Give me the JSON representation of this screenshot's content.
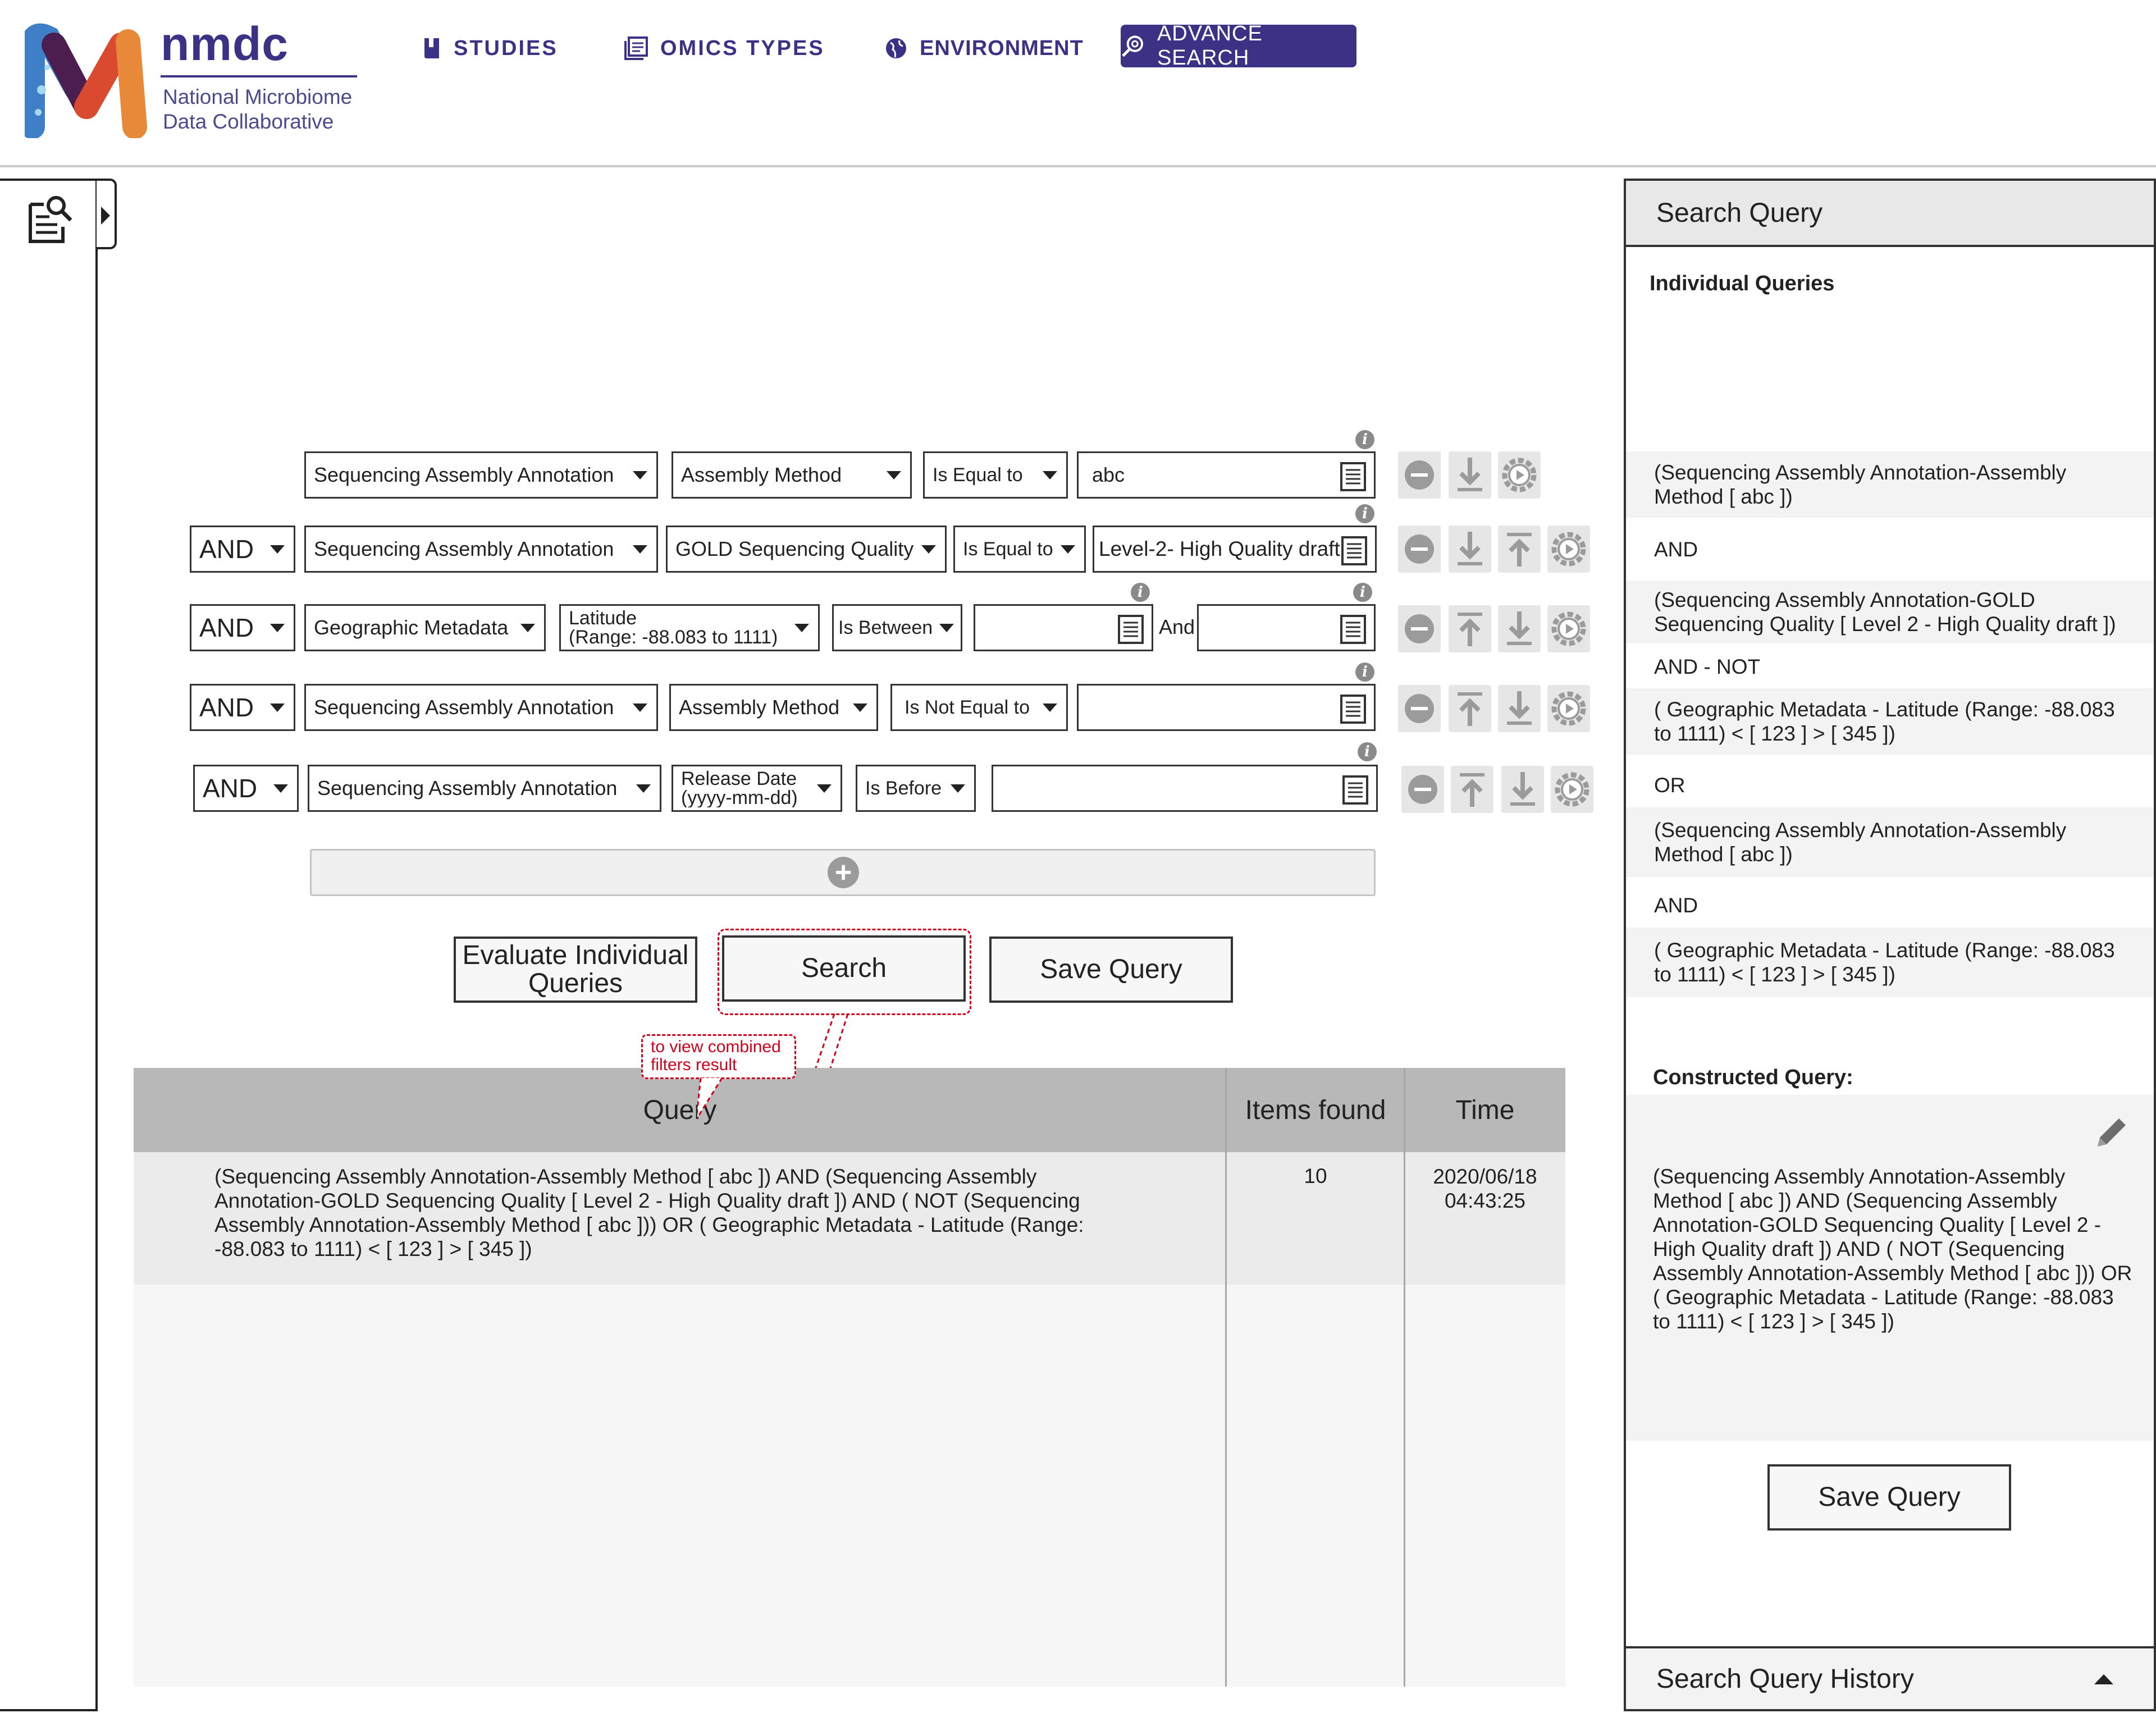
{
  "header": {
    "logo_name": "nmdc",
    "logo_sub1": "National Microbiome",
    "logo_sub2": "Data Collaborative",
    "nav": {
      "studies": "STUDIES",
      "omics": "OMICS TYPES",
      "environment": "ENVIRONMENT",
      "advance_search": "ADVANCE SEARCH"
    }
  },
  "builder": {
    "rows": [
      {
        "op": "",
        "category": "Sequencing Assembly Annotation",
        "field": "Assembly Method",
        "comparator": "Is Equal to",
        "value": "abc"
      },
      {
        "op": "AND",
        "category": "Sequencing Assembly Annotation",
        "field": "GOLD Sequencing Quality",
        "comparator": "Is Equal to",
        "value": "Level-2- High Quality draft"
      },
      {
        "op": "AND",
        "category": "Geographic Metadata",
        "field_line1": "Latitude",
        "field_line2": "(Range: -88.083 to 1111)",
        "comparator": "Is Between",
        "value": "",
        "and_label": "And",
        "value2": ""
      },
      {
        "op": "AND",
        "category": "Sequencing Assembly Annotation",
        "field": "Assembly Method",
        "comparator": "Is Not Equal to",
        "value": ""
      },
      {
        "op": "AND",
        "category": "Sequencing Assembly Annotation",
        "field_line1": "Release Date",
        "field_line2": "(yyyy-mm-dd)",
        "comparator": "Is Before",
        "value": ""
      }
    ],
    "evaluate_button": "Evaluate Individual Queries",
    "search_button": "Search",
    "save_button": "Save Query",
    "callout": "to view combined filters result"
  },
  "results": {
    "columns": [
      "Query",
      "Items found",
      "Time"
    ],
    "rows": [
      {
        "query": "(Sequencing Assembly Annotation-Assembly Method [ abc ]) AND (Sequencing Assembly Annotation-GOLD Sequencing Quality [ Level 2 - High Quality draft ]) AND ( NOT (Sequencing Assembly Annotation-Assembly Method [ abc ])) OR ( Geographic Metadata - Latitude (Range: -88.083 to 1111) < [ 123 ] > [ 345 ])",
        "items": "10",
        "time": "2020/06/18 04:43:25"
      }
    ]
  },
  "panel": {
    "title": "Search Query",
    "individual_label": "Individual Queries",
    "queries": [
      "(Sequencing Assembly Annotation-Assembly Method [ abc ])",
      "AND",
      "(Sequencing Assembly Annotation-GOLD Sequencing Quality [ Level 2 - High Quality draft ])",
      "AND - NOT",
      "( Geographic Metadata - Latitude (Range: -88.083 to 1111) < [ 123 ] > [ 345 ])",
      "OR",
      "(Sequencing Assembly Annotation-Assembly Method [ abc ])",
      "AND",
      "( Geographic Metadata - Latitude (Range: -88.083 to 1111) < [ 123 ] > [ 345 ])"
    ],
    "constructed_label": "Constructed Query:",
    "constructed_query": "(Sequencing Assembly Annotation-Assembly Method [ abc ]) AND (Sequencing Assembly Annotation-GOLD Sequencing Quality [ Level 2 - High Quality draft ]) AND ( NOT (Sequencing Assembly Annotation-Assembly Method [ abc ])) OR ( Geographic Metadata - Latitude (Range: -88.083 to 1111) < [ 123 ] > [ 345 ])",
    "save_button": "Save Query",
    "history_label": "Search Query History"
  },
  "icons": {
    "info": "i",
    "plus": "+"
  },
  "colors": {
    "brand": "#3b3286",
    "accent_red": "#d0021b"
  }
}
